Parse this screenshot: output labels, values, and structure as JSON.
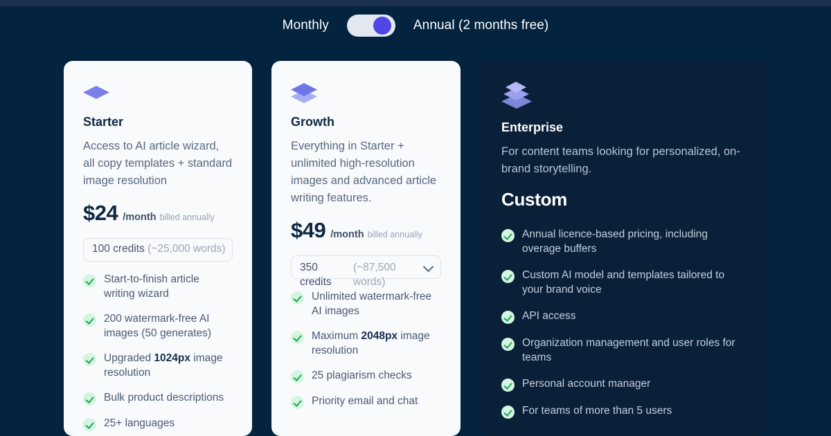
{
  "billing": {
    "monthly_label": "Monthly",
    "annual_label": "Annual (2 months free)",
    "selected": "annual"
  },
  "colors": {
    "page_bg": "#04233f",
    "top_strip": "#1c3050",
    "card_light_bg": "#f8fafc",
    "card_dark_bg": "#0a1f38",
    "accent": "#4f46e5",
    "icon_periwinkle": "#7b7fe8",
    "check_green": "#22a55c",
    "check_bg": "#d4f5df"
  },
  "plans": [
    {
      "id": "starter",
      "name": "Starter",
      "icon": "single-diamond-icon",
      "description": "Access to AI article wizard, all copy templates + standard image resolution",
      "price_amount": "$24",
      "price_period": "/month",
      "price_note": "billed annually",
      "credits": {
        "value": "100 credits",
        "words": "(~25,000 words)",
        "has_dropdown": false
      },
      "features": [
        {
          "text": "Start-to-finish article writing wizard"
        },
        {
          "text": "200 watermark-free AI images (50 generates)"
        },
        {
          "pre": "Upgraded ",
          "strong": "1024px",
          "post": " image resolution"
        },
        {
          "text": "Bulk product descriptions"
        },
        {
          "text": "25+ languages"
        }
      ]
    },
    {
      "id": "growth",
      "name": "Growth",
      "icon": "double-diamond-stack-icon",
      "description": "Everything in Starter + unlimited high-resolution images and advanced article writing features.",
      "price_amount": "$49",
      "price_period": "/month",
      "price_note": "billed annually",
      "credits": {
        "value": "350 credits",
        "words": "(~87,500 words)",
        "has_dropdown": true
      },
      "features": [
        {
          "text": "Unlimited watermark-free AI images"
        },
        {
          "pre": "Maximum ",
          "strong": "2048px",
          "post": " image resolution"
        },
        {
          "text": "25 plagiarism checks"
        },
        {
          "text": "Priority email and chat"
        }
      ]
    },
    {
      "id": "enterprise",
      "name": "Enterprise",
      "icon": "triple-diamond-stack-icon",
      "description": "For content teams looking for personalized, on-brand storytelling.",
      "price_amount": "Custom",
      "features": [
        {
          "text": "Annual licence-based pricing, including overage buffers"
        },
        {
          "text": "Custom AI model and templates tailored to your brand voice"
        },
        {
          "text": "API access"
        },
        {
          "text": "Organization management and user roles for teams"
        },
        {
          "text": "Personal account manager"
        },
        {
          "text": "For teams of more than 5 users"
        }
      ]
    }
  ]
}
